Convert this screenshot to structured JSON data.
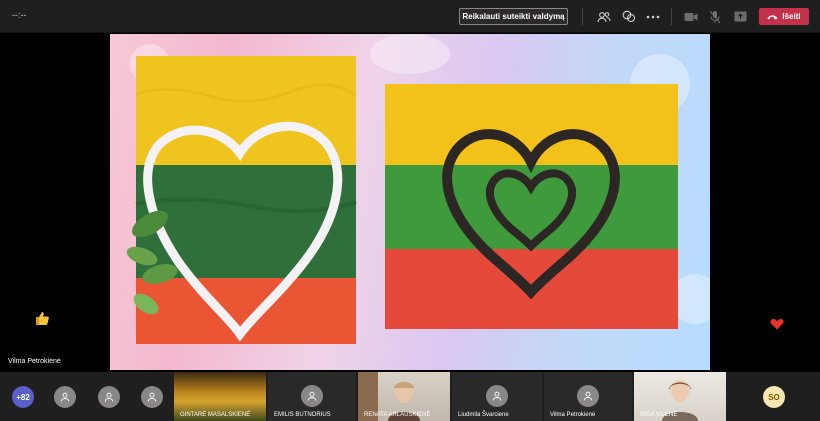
{
  "topbar": {
    "timer": "--:--",
    "request_control": "Reikalauti suteikti valdymą",
    "leave": "Išeiti",
    "icons": [
      "participants-icon",
      "chat-icon",
      "more-icon",
      "camera-off-icon",
      "mic-off-icon",
      "share-icon",
      "hangup-icon"
    ]
  },
  "stage": {
    "presenter_name": "Vilma Petrokienė",
    "reactions": [
      "thumbs-up-icon",
      "heart-icon"
    ]
  },
  "colors": {
    "flag_yellow": "#f2c21b",
    "flag_green": "#3f9a3c",
    "flag_red": "#e5493a",
    "leave_red": "#c4314b",
    "more_badge": "#5b5fc7"
  },
  "gallery": {
    "more_count": "+82",
    "participants": [
      {
        "name": "GINTARĖ MASALSKIENĖ"
      },
      {
        "name": "EMILIS BUTNORIUS"
      },
      {
        "name": "RENATA ARLAUSKIENĖ"
      },
      {
        "name": "Liudmila Švarciene"
      },
      {
        "name": "Vilma Petrokienė"
      },
      {
        "name": "INGA VILENĖ"
      }
    ],
    "so_initials": "SO"
  }
}
